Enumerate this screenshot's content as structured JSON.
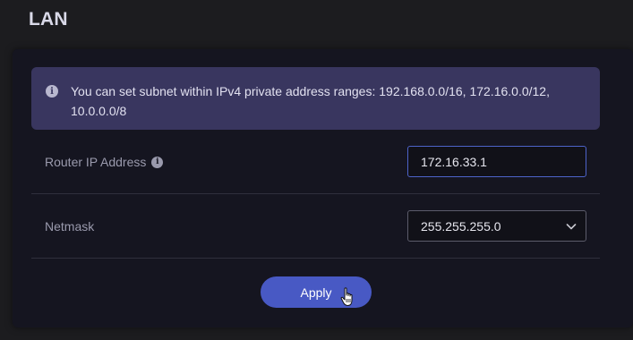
{
  "page": {
    "title": "LAN"
  },
  "info_banner": {
    "icon": "info-icon",
    "text": "You can set subnet within IPv4 private address ranges: 192.168.0.0/16, 172.16.0.0/12, 10.0.0.0/8"
  },
  "router_ip": {
    "label": "Router IP Address",
    "help_icon": "info-icon",
    "value": "172.16.33.1"
  },
  "netmask": {
    "label": "Netmask",
    "selected": "255.255.255.0"
  },
  "actions": {
    "apply_label": "Apply"
  },
  "colors": {
    "accent": "#4859c4",
    "banner_bg": "#39365f",
    "card_bg": "#151520",
    "input_focus_border": "#4d63c9"
  }
}
